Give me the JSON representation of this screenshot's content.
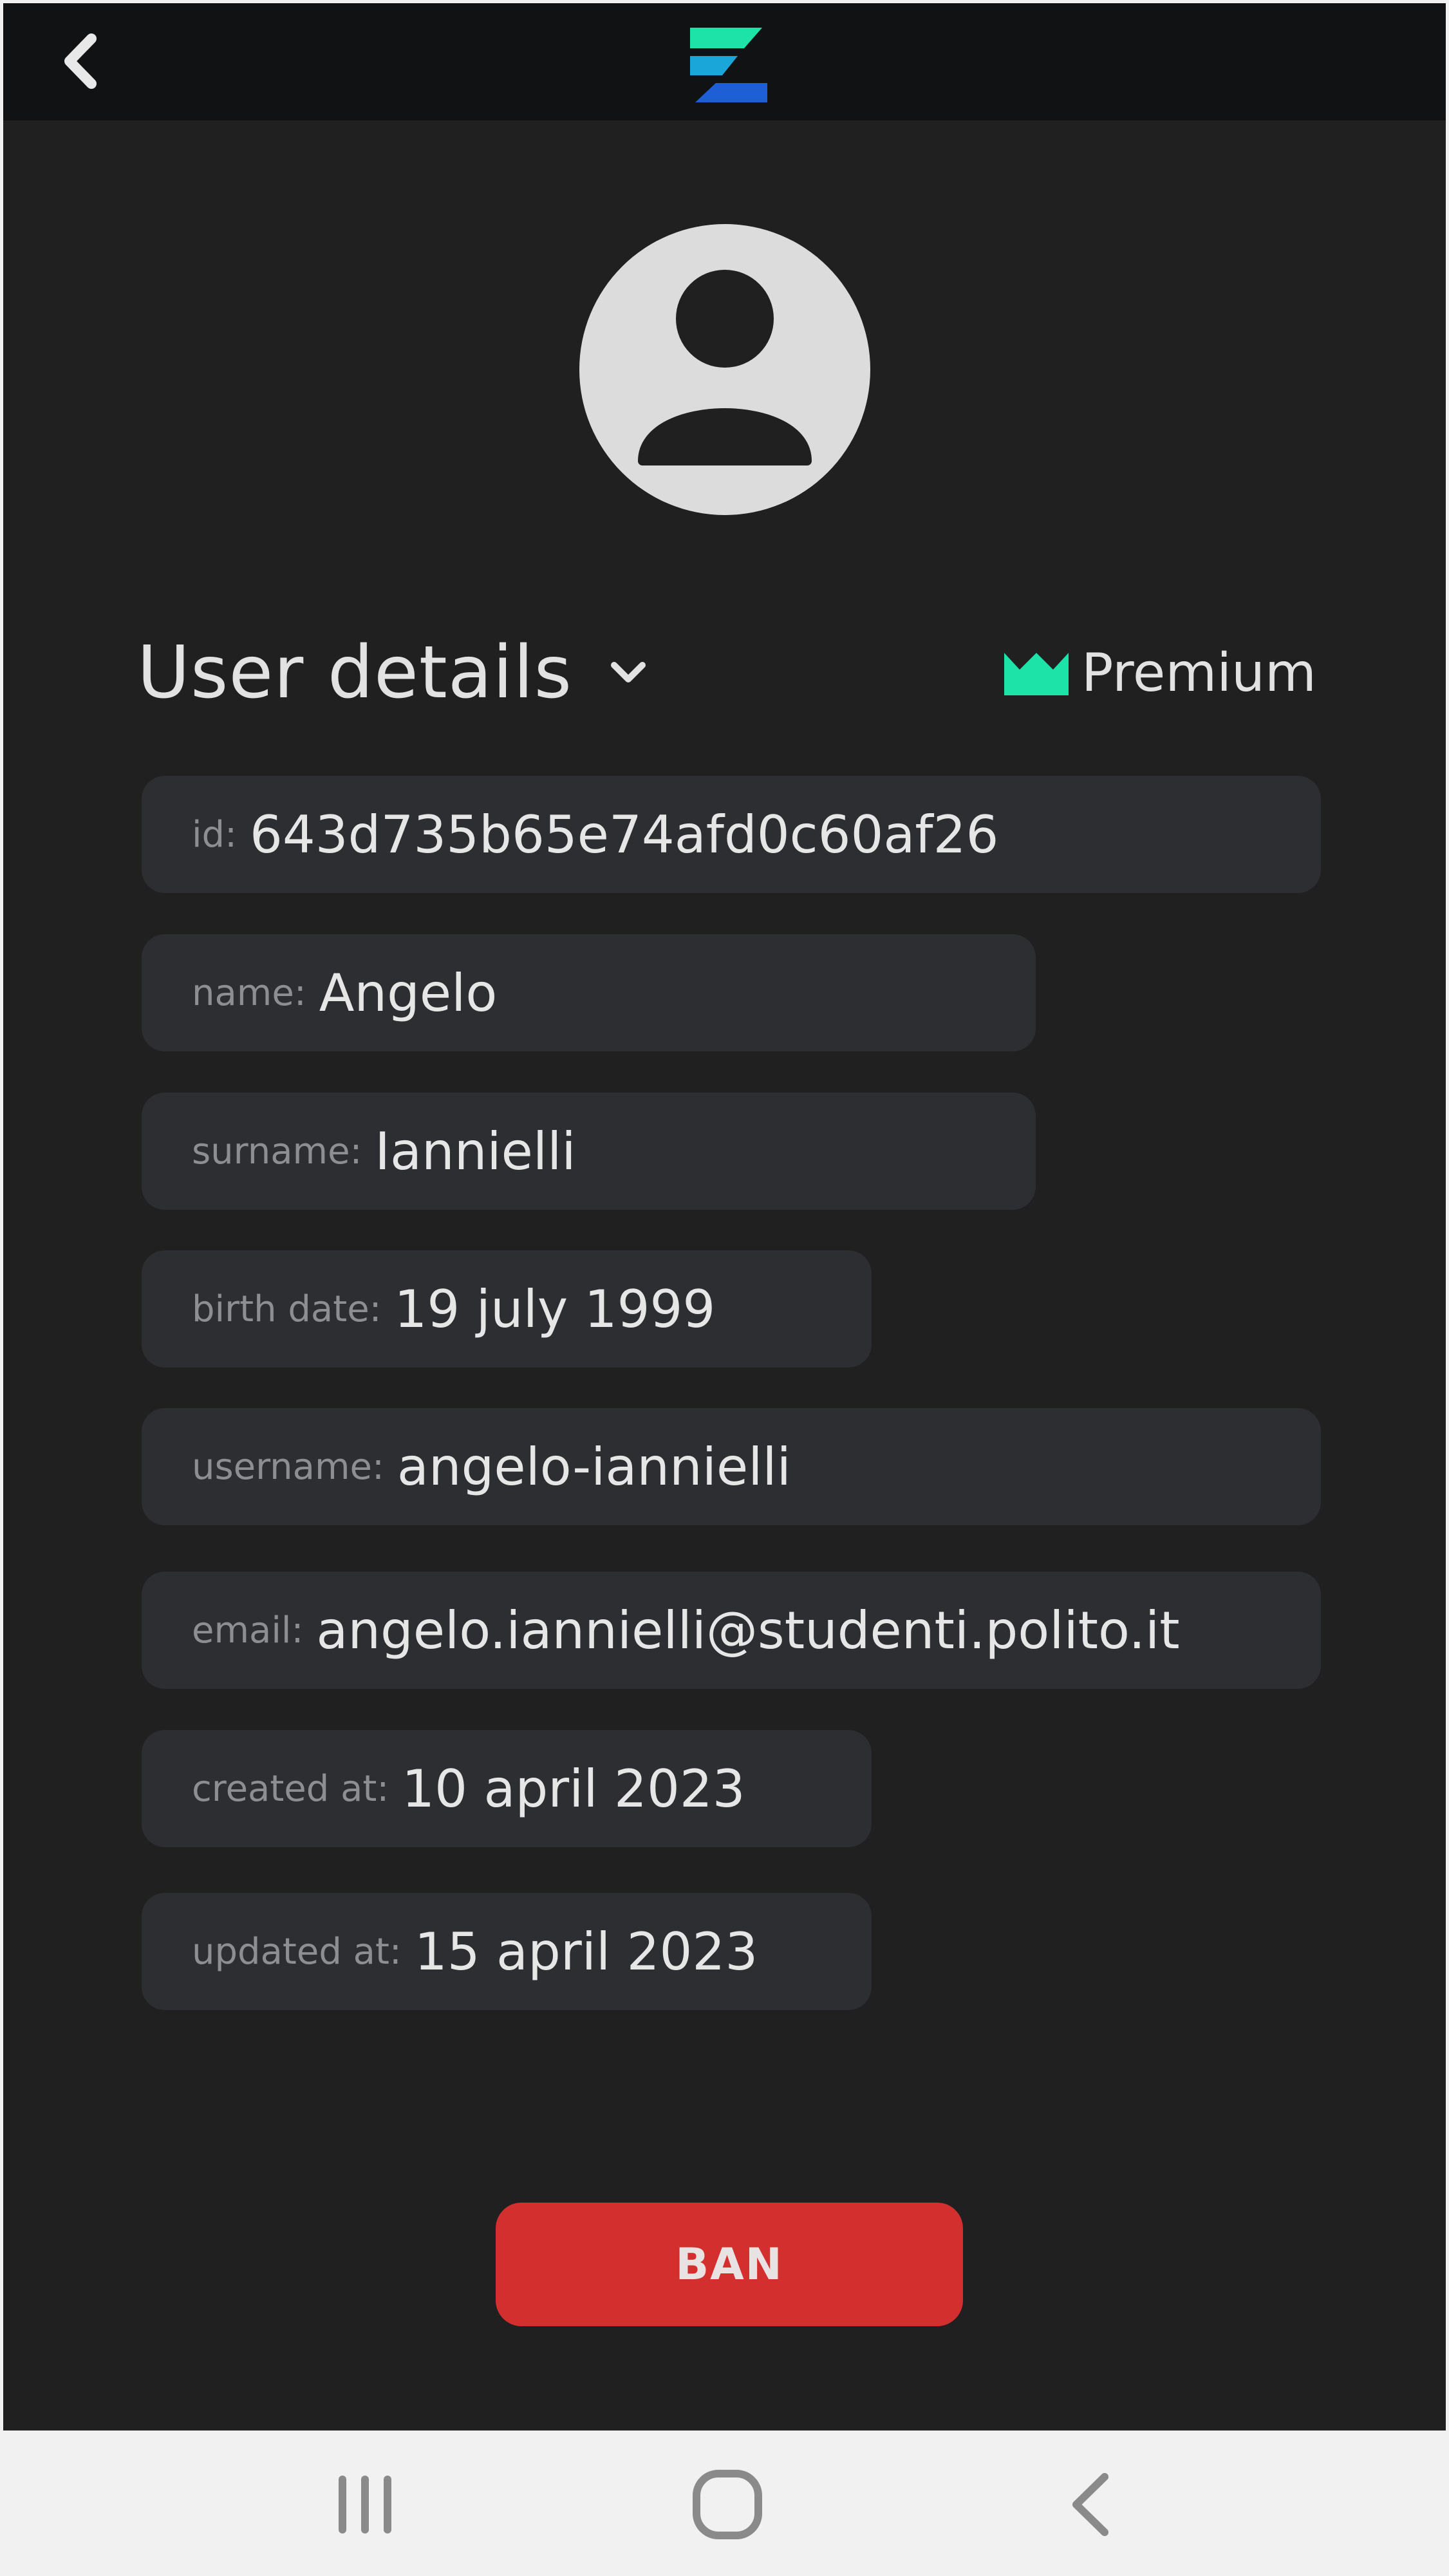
{
  "topbar": {
    "back_icon": "chevron-left-icon",
    "logo": "app-logo",
    "colors": {
      "logo_top": "#1ee3a8",
      "logo_bottom": "#1f5fd6"
    }
  },
  "profile": {
    "avatar_icon": "user-avatar-icon",
    "title": "User details",
    "toggle_icon": "chevron-down-icon",
    "badge": {
      "label": "Premium",
      "icon": "crown-icon",
      "color": "#1ee3a8"
    }
  },
  "fields": [
    {
      "key": "id:",
      "value": "643d735b65e74afd0c60af26"
    },
    {
      "key": "name:",
      "value": "Angelo"
    },
    {
      "key": "surname:",
      "value": "Iannielli"
    },
    {
      "key": "birth date:",
      "value": "19 july 1999"
    },
    {
      "key": "username:",
      "value": "angelo-iannielli"
    },
    {
      "key": "email:",
      "value": "angelo.iannielli@studenti.polito.it"
    },
    {
      "key": "created at:",
      "value": "10 april 2023"
    },
    {
      "key": "updated at:",
      "value": "15 april 2023"
    }
  ],
  "actions": {
    "ban_label": "BAN",
    "ban_color": "#d32f2f"
  },
  "system_nav": {
    "recents_icon": "recents-icon",
    "home_icon": "home-icon",
    "back_icon": "back-icon"
  }
}
